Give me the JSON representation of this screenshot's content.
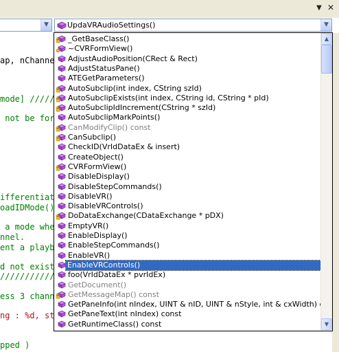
{
  "window": {
    "caption_arrow_glyph": "▼",
    "close_glyph": "✕"
  },
  "left_combo": {
    "value": "",
    "arrow": "▼"
  },
  "right_combo": {
    "value": "UpdaVRAudioSettings()",
    "arrow": "▼"
  },
  "code_lines": [
    {
      "text": "ap, nChanne",
      "cls": "plain"
    },
    {
      "text": "mode] //////",
      "cls": "cmt"
    },
    {
      "text": " not be for",
      "cls": "cmt"
    },
    {
      "text": "ifferentiate",
      "cls": "cmt"
    },
    {
      "text": "oadIDMode()",
      "cls": "cmt"
    },
    {
      "text": " a mode wher",
      "cls": "cmt"
    },
    {
      "text": "nnel.",
      "cls": "cmt"
    },
    {
      "text": "ent a playb",
      "cls": "cmt"
    },
    {
      "text": "d not exist",
      "cls": "cmt"
    },
    {
      "text": "///////////",
      "cls": "cmt"
    },
    {
      "text": "ess 3 chann",
      "cls": "cmt"
    },
    {
      "text": "ng : %d, st",
      "cls": "str"
    },
    {
      "text": "pped )",
      "cls": "cmt"
    }
  ],
  "dropdown": {
    "items": [
      {
        "label": "_GetBaseClass()",
        "icon": "protected-method-icon",
        "state": "normal"
      },
      {
        "label": "~CVRFormView()",
        "icon": "public-method-icon",
        "state": "normal"
      },
      {
        "label": "AdjustAudioPosition(CRect & Rect)",
        "icon": "method-icon",
        "state": "normal"
      },
      {
        "label": "AdjustStatusPane()",
        "icon": "method-icon",
        "state": "normal"
      },
      {
        "label": "ATEGetParameters()",
        "icon": "method-icon",
        "state": "normal"
      },
      {
        "label": "AutoSubclip(int index, CString szId)",
        "icon": "protected-method-icon",
        "state": "normal"
      },
      {
        "label": "AutoSubclipExists(int index, CString id, CString * pId)",
        "icon": "protected-method-icon",
        "state": "normal"
      },
      {
        "label": "AutoSubclipIdIncrement(CString * szId)",
        "icon": "protected-method-icon",
        "state": "normal"
      },
      {
        "label": "AutoSubclipMarkPoints()",
        "icon": "method-icon",
        "state": "normal"
      },
      {
        "label": "CanModifyClip() const",
        "icon": "protected-method-icon",
        "state": "grey"
      },
      {
        "label": "CanSubclip()",
        "icon": "protected-method-icon",
        "state": "normal"
      },
      {
        "label": "CheckID(VrIdDataEx & insert)",
        "icon": "method-icon",
        "state": "normal"
      },
      {
        "label": "CreateObject()",
        "icon": "method-icon",
        "state": "normal"
      },
      {
        "label": "CVRFormView()",
        "icon": "protected-method-icon",
        "state": "normal"
      },
      {
        "label": "DisableDisplay()",
        "icon": "method-icon",
        "state": "normal"
      },
      {
        "label": "DisableStepCommands()",
        "icon": "method-icon",
        "state": "normal"
      },
      {
        "label": "DisableVR()",
        "icon": "method-icon",
        "state": "normal"
      },
      {
        "label": "DisableVRControls()",
        "icon": "method-icon",
        "state": "normal"
      },
      {
        "label": "DoDataExchange(CDataExchange * pDX)",
        "icon": "protected-method-icon",
        "state": "normal"
      },
      {
        "label": "EmptyVR()",
        "icon": "method-icon",
        "state": "normal"
      },
      {
        "label": "EnableDisplay()",
        "icon": "method-icon",
        "state": "normal"
      },
      {
        "label": "EnableStepCommands()",
        "icon": "method-icon",
        "state": "normal"
      },
      {
        "label": "EnableVR()",
        "icon": "method-icon",
        "state": "normal"
      },
      {
        "label": "EnableVRControls()",
        "icon": "method-icon",
        "state": "selected"
      },
      {
        "label": "foo(VrIdDataEx * pvrIdEx)",
        "icon": "method-icon",
        "state": "normal"
      },
      {
        "label": "GetDocument()",
        "icon": "method-icon",
        "state": "grey"
      },
      {
        "label": "GetMessageMap() const",
        "icon": "protected-method-icon",
        "state": "grey"
      },
      {
        "label": "GetPaneInfo(int nIndex, UINT & nID, UINT & nStyle, int & cxWidth) const",
        "icon": "method-icon",
        "state": "normal"
      },
      {
        "label": "GetPaneText(int nIndex) const",
        "icon": "method-icon",
        "state": "normal"
      },
      {
        "label": "GetRuntimeClass() const",
        "icon": "method-icon",
        "state": "normal"
      }
    ]
  },
  "scrollbar": {
    "up_glyph": "▲",
    "down_glyph": "▼",
    "position_fraction": 0.0
  },
  "colors": {
    "selection": "#316ac5",
    "comment": "#008000",
    "method_icon": "#b04ad6"
  }
}
